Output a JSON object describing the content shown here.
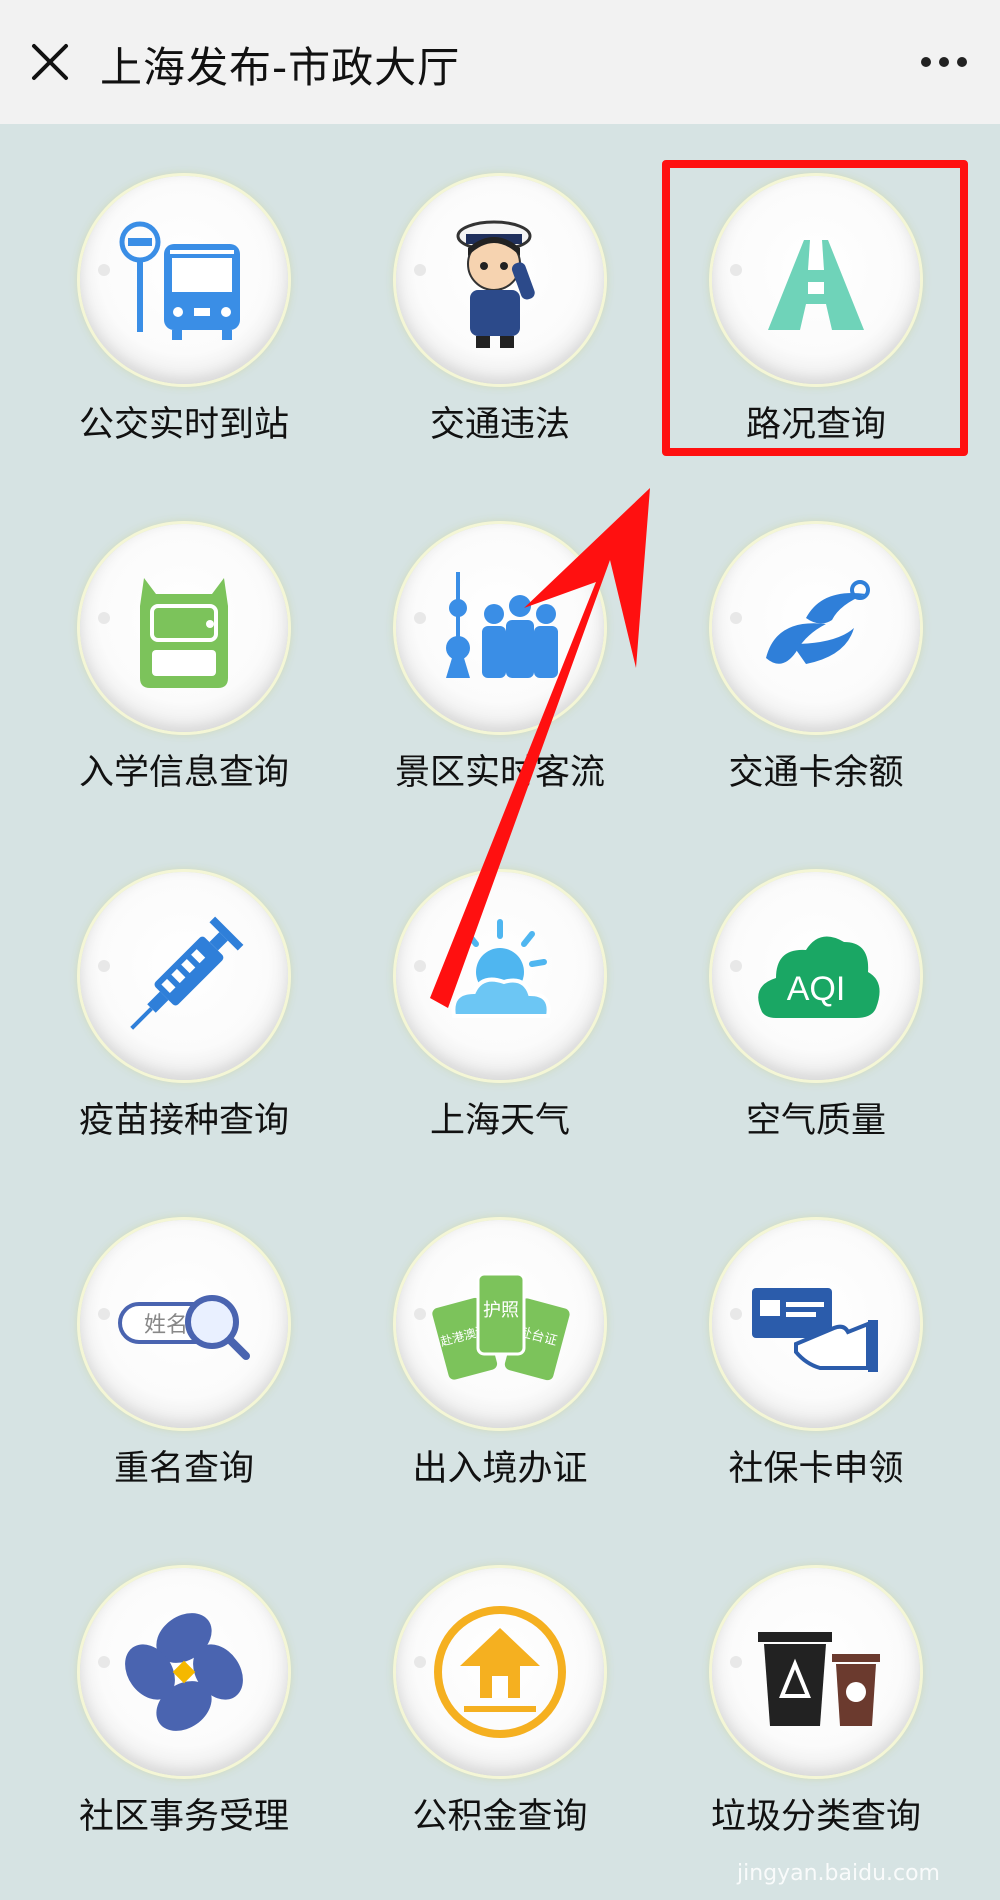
{
  "header": {
    "title": "上海发布-市政大厅",
    "close_icon": "close-icon",
    "more_icon": "more-dots-icon"
  },
  "tiles": [
    {
      "label": "公交实时到站",
      "icon": "bus-stop-icon"
    },
    {
      "label": "交通违法",
      "icon": "traffic-police-icon"
    },
    {
      "label": "路况查询",
      "icon": "road-icon"
    },
    {
      "label": "入学信息查询",
      "icon": "backpack-icon"
    },
    {
      "label": "景区实时客流",
      "icon": "crowd-tower-icon"
    },
    {
      "label": "交通卡余额",
      "icon": "transport-card-logo-icon"
    },
    {
      "label": "疫苗接种查询",
      "icon": "syringe-icon"
    },
    {
      "label": "上海天气",
      "icon": "weather-icon"
    },
    {
      "label": "空气质量",
      "icon": "aqi-cloud-icon",
      "icon_text": "AQI"
    },
    {
      "label": "重名查询",
      "icon": "name-search-icon",
      "icon_text": "姓名"
    },
    {
      "label": "出入境办证",
      "icon": "travel-documents-icon",
      "icon_text": [
        "赴港澳证",
        "护照",
        "赴台证"
      ]
    },
    {
      "label": "社保卡申领",
      "icon": "card-hand-icon"
    },
    {
      "label": "社区事务受理",
      "icon": "community-logo-icon"
    },
    {
      "label": "公积金查询",
      "icon": "housing-fund-icon"
    },
    {
      "label": "垃圾分类查询",
      "icon": "trash-bins-icon"
    }
  ],
  "annotation": {
    "highlight_color": "#ff1010",
    "highlighted_tile": "路况查询"
  },
  "watermark": "jingyan.baidu.com"
}
